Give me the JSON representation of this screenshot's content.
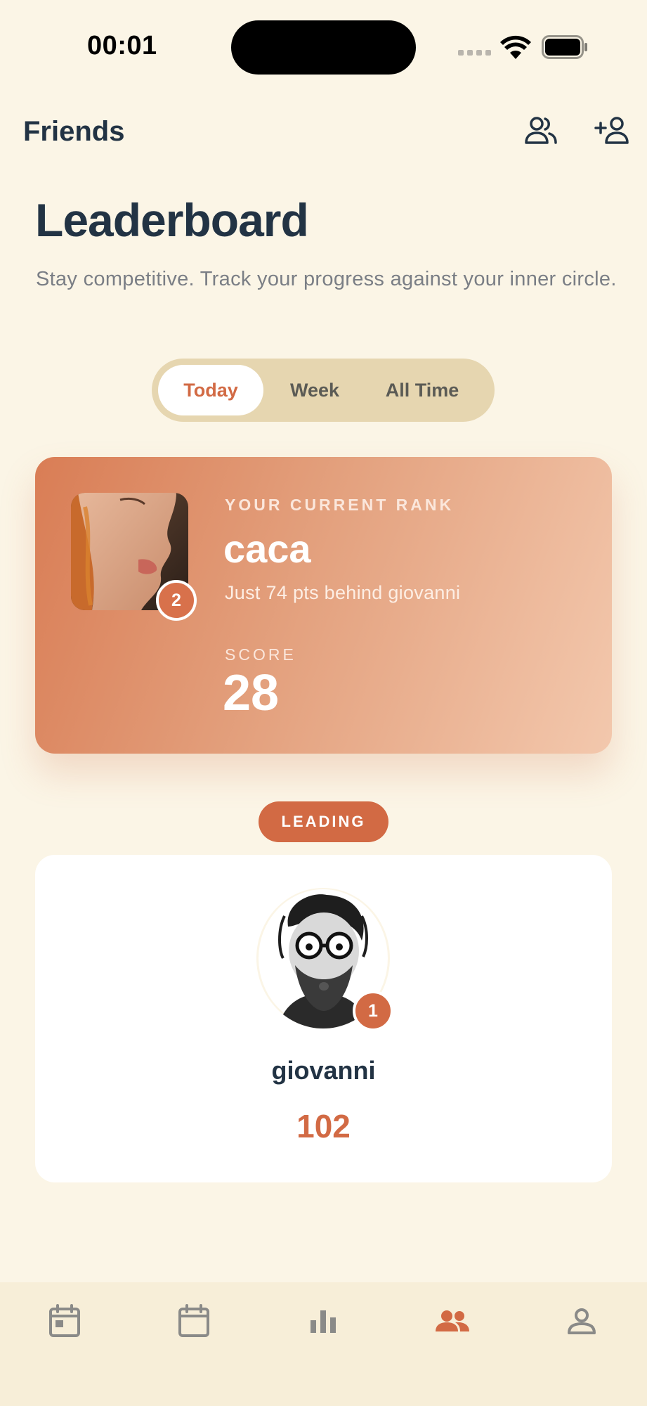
{
  "status_bar": {
    "time": "00:01"
  },
  "header": {
    "title": "Friends",
    "icons": [
      "friends-icon",
      "add-friend-icon"
    ]
  },
  "page": {
    "title": "Leaderboard",
    "subtitle": "Stay competitive. Track your progress against your inner circle."
  },
  "tabs": [
    {
      "label": "Today",
      "selected": true
    },
    {
      "label": "Week",
      "selected": false
    },
    {
      "label": "All Time",
      "selected": false
    }
  ],
  "rank_card": {
    "label": "YOUR CURRENT RANK",
    "name": "caca",
    "rank": "2",
    "behind_text": "Just 74 pts behind giovanni",
    "score_label": "SCORE",
    "score": "28"
  },
  "leader": {
    "pill": "LEADING",
    "name": "giovanni",
    "rank": "1",
    "score": "102"
  },
  "bottom_nav": {
    "items": [
      {
        "icon": "daily-calendar-icon",
        "active": false
      },
      {
        "icon": "calendar-icon",
        "active": false
      },
      {
        "icon": "stats-icon",
        "active": false
      },
      {
        "icon": "friends-icon",
        "active": true
      },
      {
        "icon": "profile-icon",
        "active": false
      }
    ]
  },
  "colors": {
    "background": "#fbf5e6",
    "accent": "#d26a44",
    "text_dark": "#223344",
    "segment_bg": "#e6d6b0",
    "nav_inactive": "#8a8a88"
  }
}
